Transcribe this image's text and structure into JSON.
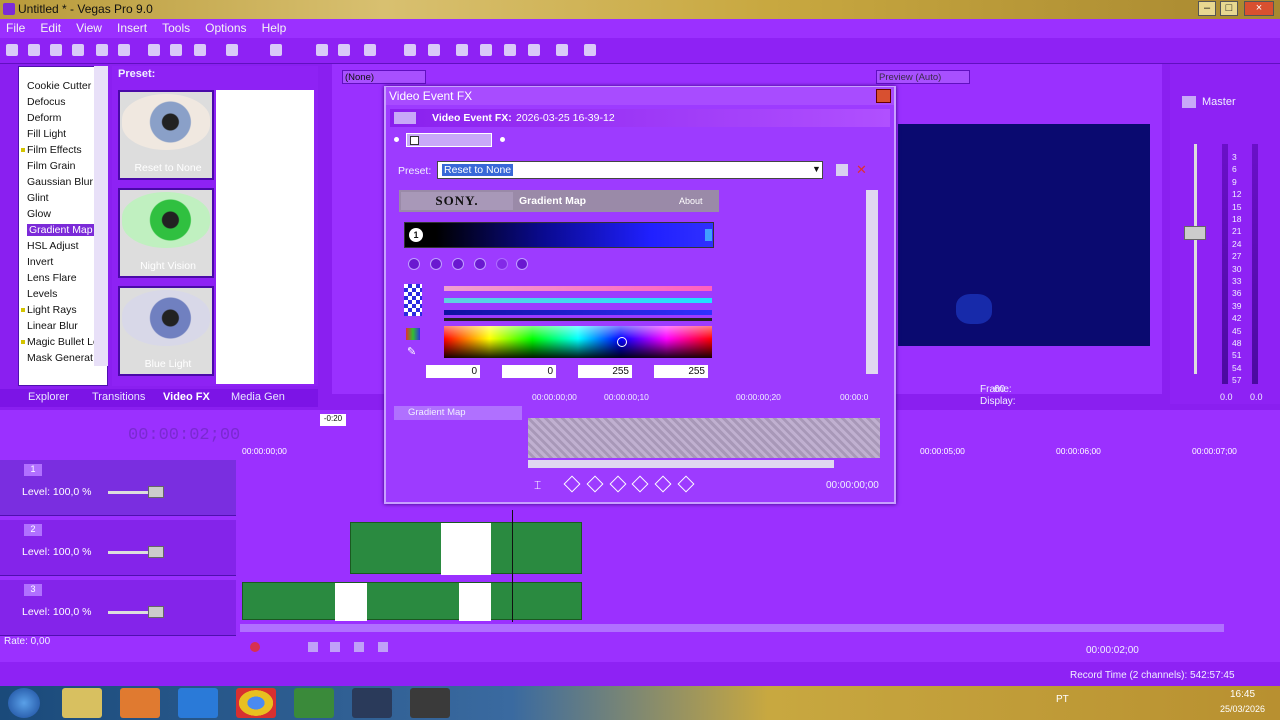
{
  "window": {
    "title": "Untitled * - Vegas Pro 9.0"
  },
  "menu": [
    "File",
    "Edit",
    "View",
    "Insert",
    "Tools",
    "Options",
    "Help"
  ],
  "toolbar": {
    "preview_select": "(None)",
    "preview_quality": "Preview (Auto)"
  },
  "fx_list": {
    "items": [
      "Cookie Cutter",
      "Defocus",
      "Deform",
      "Fill Light",
      "Film Effects",
      "Film Grain",
      "Gaussian Blur",
      "Glint",
      "Glow",
      "Gradient Map",
      "HSL Adjust",
      "Invert",
      "Lens Flare",
      "Levels",
      "Light Rays",
      "Linear Blur",
      "Magic Bullet Lo",
      "Mask Generat"
    ],
    "selected": "Gradient Map"
  },
  "presets": {
    "label": "Preset:",
    "items": [
      {
        "name": "Reset to None",
        "tint": "#8aa0c8"
      },
      {
        "name": "Night Vision",
        "tint": "#30c040"
      },
      {
        "name": "Blue Light",
        "tint": "#7080c0"
      }
    ]
  },
  "tabs": [
    "Explorer",
    "Transitions",
    "Video FX",
    "Media Gen"
  ],
  "active_tab": "Video FX",
  "preview": {
    "frame_label": "Frame:",
    "frame_value": "60",
    "display_label": "Display:"
  },
  "master": {
    "label": "Master",
    "scale": [
      "3",
      "6",
      "9",
      "12",
      "15",
      "18",
      "21",
      "24",
      "27",
      "30",
      "33",
      "36",
      "39",
      "42",
      "45",
      "48",
      "51",
      "54",
      "57"
    ],
    "left_value": "0.0",
    "right_value": "0.0"
  },
  "dialog": {
    "title": "Video Event FX",
    "header_prefix": "Video Event FX:",
    "header_value": "2026-03-25 16-39-12",
    "preset_label": "Preset:",
    "preset_value": "Reset to None",
    "sony": "SONY.",
    "plugin_name": "Gradient Map",
    "about": "About",
    "stop_number": "1",
    "values": [
      "0",
      "0",
      "255",
      "255"
    ],
    "track_name": "Gradient Map",
    "time_marks": [
      "00:00:00;00",
      "00:00:00;10",
      "00:00:00;20",
      "00:00:0"
    ],
    "time_position": "00:00:00;00"
  },
  "timeline": {
    "time": "00:00:02;00",
    "marker": "-0:20",
    "ruler": [
      "00:00:00;00",
      "00:00:05;00",
      "00:00:06;00",
      "00:00:07;00"
    ],
    "tracks": [
      {
        "number": "1",
        "level": "Level: 100,0 %"
      },
      {
        "number": "2",
        "level": "Level: 100,0 %"
      },
      {
        "number": "3",
        "level": "Level: 100,0 %"
      }
    ],
    "rate": "Rate: 0,00",
    "position": "00:00:02;00"
  },
  "status": {
    "record_time": "Record Time (2 channels): 542:57:45"
  },
  "taskbar": {
    "lang": "PT",
    "time": "16:45",
    "date": "25/03/2026"
  },
  "colors": {
    "accent": "#9b30ff",
    "selection": "#7b2ad8",
    "clip": "#2a8a40"
  }
}
